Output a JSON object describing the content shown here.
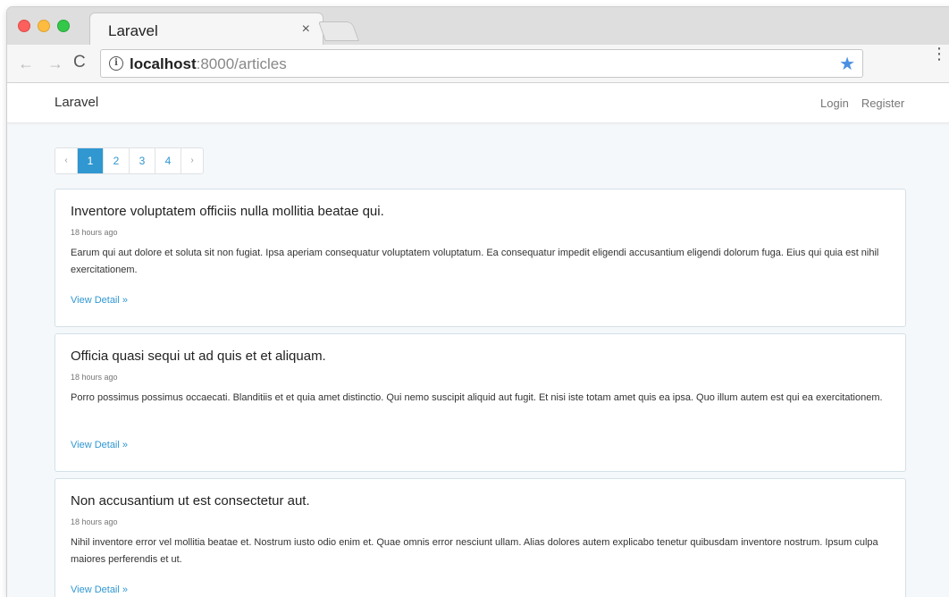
{
  "browser": {
    "tab_title": "Laravel",
    "tab_close": "×",
    "nav_back": "←",
    "nav_forward": "→",
    "nav_reload": "C",
    "info_glyph": "i",
    "url_host": "localhost",
    "url_rest": ":8000/articles",
    "star_glyph": "★",
    "menu_glyph": "⋮"
  },
  "app": {
    "brand": "Laravel",
    "nav_links": [
      "Login",
      "Register"
    ]
  },
  "pagination": {
    "prev": "‹",
    "pages": [
      "1",
      "2",
      "3",
      "4"
    ],
    "active_page": "1",
    "next": "›"
  },
  "articles": [
    {
      "title": "Inventore voluptatem officiis nulla mollitia beatae qui.",
      "time": "18 hours ago",
      "body": "Earum qui aut dolore et soluta sit non fugiat. Ipsa aperiam consequatur voluptatem voluptatum. Ea consequatur impedit eligendi accusantium eligendi dolorum fuga. Eius qui quia est nihil exercitationem.",
      "link": "View Detail »"
    },
    {
      "title": "Officia quasi sequi ut ad quis et et aliquam.",
      "time": "18 hours ago",
      "body": "Porro possimus possimus occaecati. Blanditiis et et quia amet distinctio. Qui nemo suscipit aliquid aut fugit. Et nisi iste totam amet quis ea ipsa. Quo illum autem est qui ea exercitationem.",
      "link": "View Detail »"
    },
    {
      "title": "Non accusantium ut est consectetur aut.",
      "time": "18 hours ago",
      "body": "Nihil inventore error vel mollitia beatae et. Nostrum iusto odio enim et. Quae omnis error nesciunt ullam. Alias dolores autem explicabo tenetur quibusdam inventore nostrum. Ipsum culpa maiores perferendis et ut.",
      "link": "View Detail »"
    }
  ],
  "colors": {
    "accent": "#3097d1",
    "page_bg": "#f5f8fa"
  }
}
